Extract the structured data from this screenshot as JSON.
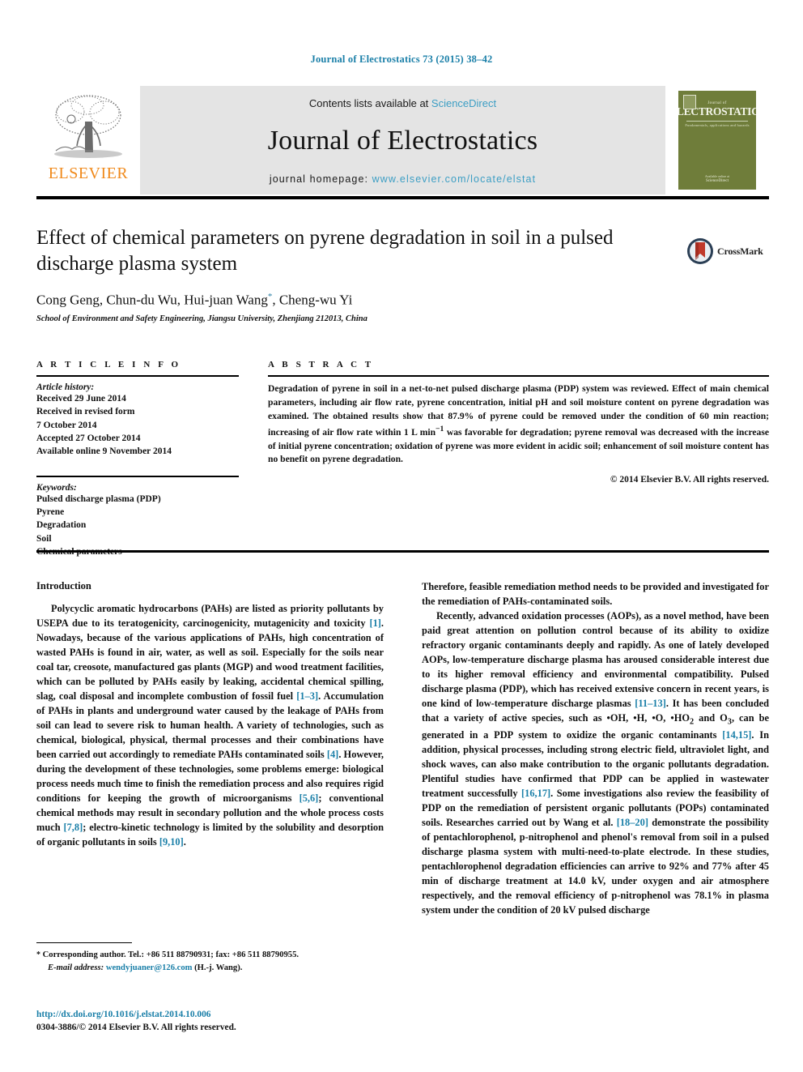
{
  "running_head": "Journal of Electrostatics 73 (2015) 38–42",
  "masthead": {
    "contents_prefix": "Contents lists available at ",
    "contents_link": "ScienceDirect",
    "journal_name": "Journal of Electrostatics",
    "homepage_prefix": "journal homepage: ",
    "homepage_url": "www.elsevier.com/locate/elstat",
    "elsevier_wordmark": "ELSEVIER",
    "elsevier_orange": "#f08a1c",
    "sciencedirect_blue": "#3c9ec4",
    "cover": {
      "small_top": "Journal of",
      "title": "ELECTROSTATICS",
      "tagline": "Fundamentals, applications and hazards",
      "bottom_small": "Available online at",
      "bottom_brand": "ScienceDirect",
      "background": "#6f7d3a"
    }
  },
  "article": {
    "title": "Effect of chemical parameters on pyrene degradation in soil in a pulsed discharge plasma system",
    "authors_part1": "Cong Geng, Chun-du Wu, Hui-juan Wang",
    "authors_marker": "*",
    "authors_part2": ", Cheng-wu Yi",
    "affiliation": "School of Environment and Safety Engineering, Jiangsu University, Zhenjiang 212013, China",
    "crossmark_label": "CrossMark"
  },
  "article_info": {
    "heading": "A R T I C L E   I N F O",
    "history_label": "Article history:",
    "history": [
      "Received 29 June 2014",
      "Received in revised form",
      "7 October 2014",
      "Accepted 27 October 2014",
      "Available online 9 November 2014"
    ],
    "keywords_label": "Keywords:",
    "keywords": [
      "Pulsed discharge plasma (PDP)",
      "Pyrene",
      "Degradation",
      "Soil",
      "Chemical parameters"
    ]
  },
  "abstract": {
    "heading": "A B S T R A C T",
    "text": "Degradation of pyrene in soil in a net-to-net pulsed discharge plasma (PDP) system was reviewed. Effect of main chemical parameters, including air flow rate, pyrene concentration, initial pH and soil moisture content on pyrene degradation was examined. The obtained results show that 87.9% of pyrene could be removed under the condition of 60 min reaction; increasing of air flow rate within 1 L min−1 was favorable for degradation; pyrene removal was decreased with the increase of initial pyrene concentration; oxidation of pyrene was more evident in acidic soil; enhancement of soil moisture content has no benefit on pyrene degradation.",
    "copyright": "© 2014 Elsevier B.V. All rights reserved."
  },
  "body": {
    "intro_heading": "Introduction",
    "left_paragraph_1": "Polycyclic aromatic hydrocarbons (PAHs) are listed as priority pollutants by USEPA due to its teratogenicity, carcinogenicity, mutagenicity and toxicity [1]. Nowadays, because of the various applications of PAHs, high concentration of wasted PAHs is found in air, water, as well as soil. Especially for the soils near coal tar, creosote, manufactured gas plants (MGP) and wood treatment facilities, which can be polluted by PAHs easily by leaking, accidental chemical spilling, slag, coal disposal and incomplete combustion of fossil fuel [1–3]. Accumulation of PAHs in plants and underground water caused by the leakage of PAHs from soil can lead to severe risk to human health. A variety of technologies, such as chemical, biological, physical, thermal processes and their combinations have been carried out accordingly to remediate PAHs contaminated soils [4]. However, during the development of these technologies, some problems emerge: biological process needs much time to finish the remediation process and also requires rigid conditions for keeping the growth of microorganisms [5,6]; conventional chemical methods may result in secondary pollution and the whole process costs much [7,8]; electro-kinetic technology is limited by the solubility and desorption of organic pollutants in soils [9,10].",
    "right_paragraph_1": "Therefore, feasible remediation method needs to be provided and investigated for the remediation of PAHs-contaminated soils.",
    "right_paragraph_2": "Recently, advanced oxidation processes (AOPs), as a novel method, have been paid great attention on pollution control because of its ability to oxidize refractory organic contaminants deeply and rapidly. As one of lately developed AOPs, low-temperature discharge plasma has aroused considerable interest due to its higher removal efficiency and environmental compatibility. Pulsed discharge plasma (PDP), which has received extensive concern in recent years, is one kind of low-temperature discharge plasmas [11–13]. It has been concluded that a variety of active species, such as •OH, •H, •O, •HO2 and O3, can be generated in a PDP system to oxidize the organic contaminants [14,15]. In addition, physical processes, including strong electric field, ultraviolet light, and shock waves, can also make contribution to the organic pollutants degradation. Plentiful studies have confirmed that PDP can be applied in wastewater treatment successfully [16,17]. Some investigations also review the feasibility of PDP on the remediation of persistent organic pollutants (POPs) contaminated soils. Researches carried out by Wang et al. [18–20] demonstrate the possibility of pentachlorophenol, p-nitrophenol and phenol's removal from soil in a pulsed discharge plasma system with multi-need-to-plate electrode. In these studies, pentachlorophenol degradation efficiencies can arrive to 92% and 77% after 45 min of discharge treatment at 14.0 kV, under oxygen and air atmosphere respectively, and the removal efficiency of p-nitrophenol was 78.1% in plasma system under the condition of 20 kV pulsed discharge"
  },
  "footnote": {
    "star": "*",
    "corresponding": " Corresponding author. Tel.: +86 511 88790931; fax: +86 511 88790955.",
    "email_label": "E-mail address:",
    "email": "wendyjuaner@126.com",
    "email_suffix": " (H.-j. Wang)."
  },
  "publisher_footer": {
    "doi": "http://dx.doi.org/10.1016/j.elstat.2014.10.006",
    "issn_copyright": "0304-3886/© 2014 Elsevier B.V. All rights reserved."
  }
}
